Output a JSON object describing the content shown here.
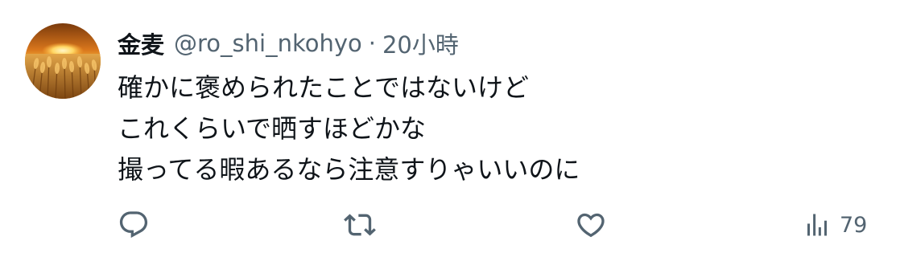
{
  "tweet": {
    "author": {
      "display_name": "金麦",
      "handle": "@ro_shi_nkohyo",
      "separator": "·",
      "timestamp": "20小時",
      "avatar_icon": "wheat-field-sunset-avatar"
    },
    "lines": [
      "確かに褒められたことではないけど",
      "これくらいで晒すほどかな",
      "撮ってる暇あるなら注意すりゃいいのに"
    ],
    "actions": {
      "reply_icon": "reply-icon",
      "retweet_icon": "retweet-icon",
      "like_icon": "heart-icon",
      "views_icon": "views-chart-icon",
      "views_count": "79"
    },
    "colors": {
      "text_primary": "#0f1419",
      "text_secondary": "#536471"
    }
  }
}
